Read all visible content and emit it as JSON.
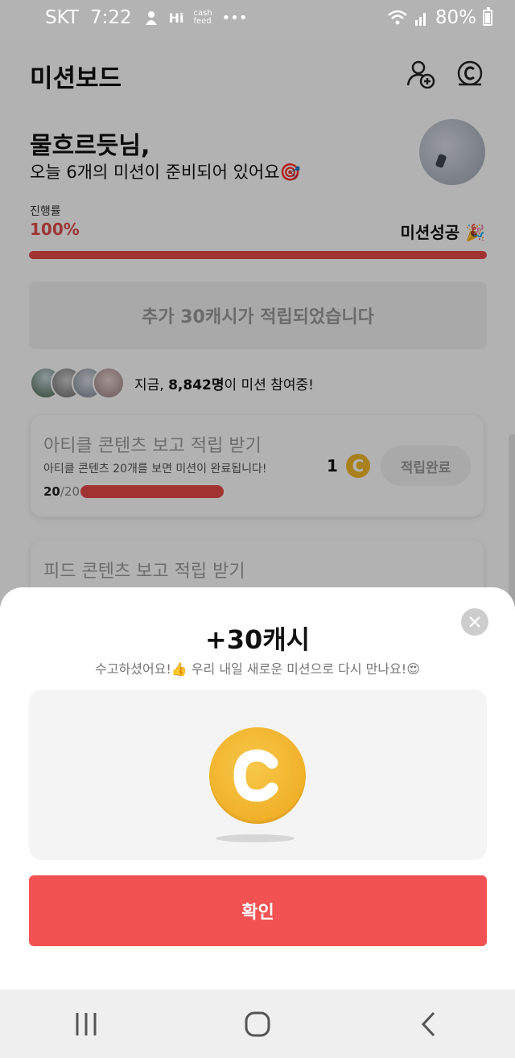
{
  "status_bar": {
    "carrier": "SKT",
    "time": "7:22",
    "battery": "80%"
  },
  "header": {
    "title": "미션보드",
    "add_friend_icon": "add-friend-icon",
    "coin_icon": "coin-icon"
  },
  "greeting": {
    "name": "물흐르듯님,",
    "subtitle": "오늘 6개의 미션이 준비되어 있어요🎯"
  },
  "progress": {
    "label": "진행률",
    "value": "100%",
    "fraction": 1.0,
    "success_label": "미션성공 🎉"
  },
  "bonus_banner": "추가 30캐시가 적립되었습니다",
  "participants": {
    "prefix": "지금, ",
    "count": "8,842명",
    "suffix": "이 미션 참여중!"
  },
  "missions": [
    {
      "title": "아티클 콘텐츠 보고 적립 받기",
      "description": "아티클 콘텐츠 20개를 보면 미션이 완료됩니다!",
      "progress_current": "20",
      "progress_total": "/20",
      "reward": "1",
      "button": "적립완료"
    },
    {
      "title": "피드 콘텐츠 보고 적립 받기"
    }
  ],
  "reward_sheet": {
    "title": "+30캐시",
    "subtitle": "수고하셨어요!👍 우리 내일 새로운 미션으로 다시 만나요!😍",
    "coin_symbol": "C",
    "confirm_label": "확인"
  },
  "colors": {
    "accent_red": "#f25252",
    "coin_gold": "#f3b929"
  }
}
